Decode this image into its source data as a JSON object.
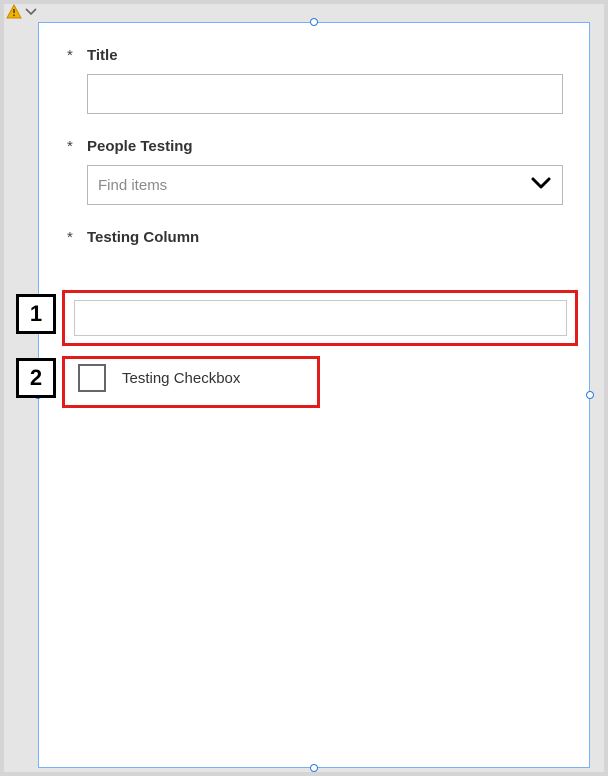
{
  "toolbar": {
    "warning_icon": "warning-icon",
    "dropdown_icon": "chevron-down-icon"
  },
  "form": {
    "title": {
      "required": "*",
      "label": "Title",
      "value": ""
    },
    "people_testing": {
      "required": "*",
      "label": "People Testing",
      "placeholder": "Find items"
    },
    "testing_column": {
      "required": "*",
      "label": "Testing Column",
      "value": ""
    },
    "testing_checkbox": {
      "label": "Testing Checkbox",
      "checked": false
    }
  },
  "callouts": {
    "one": "1",
    "two": "2"
  }
}
